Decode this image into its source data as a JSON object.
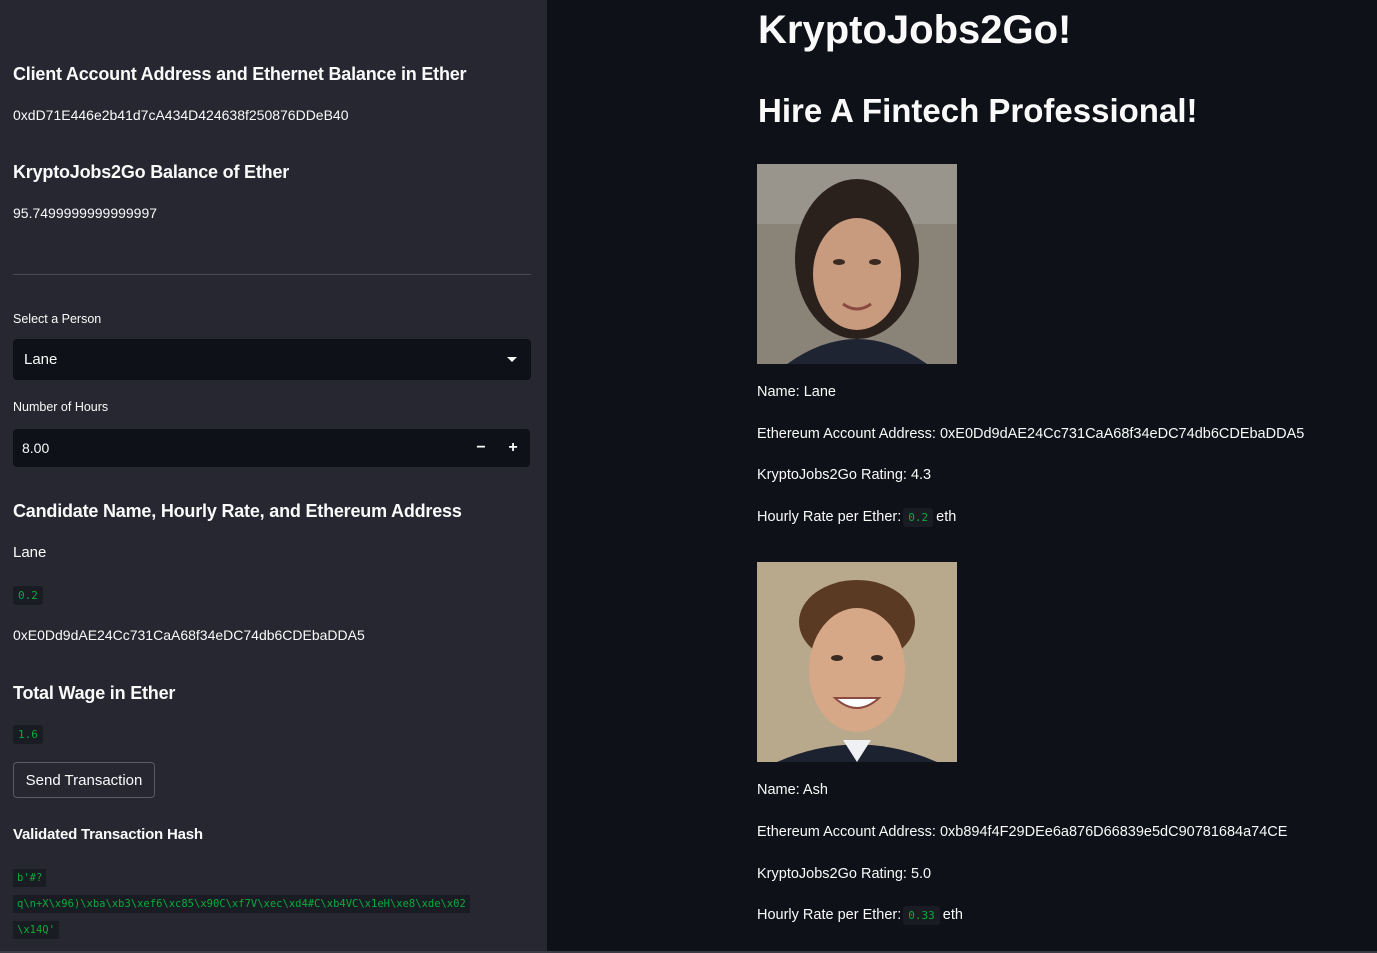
{
  "sidebar": {
    "client_heading": "Client Account Address and Ethernet Balance in Ether",
    "client_address": "0xdD71E446e2b41d7cA434D424638f250876DDeB40",
    "balance_heading": "KryptoJobs2Go Balance of Ether",
    "balance_value": "95.7499999999999997",
    "select_label": "Select a Person",
    "select_value": "Lane",
    "hours_label": "Number of Hours",
    "hours_value": "8.00",
    "minus": "−",
    "plus": "+",
    "candidate_heading": "Candidate Name, Hourly Rate, and Ethereum Address",
    "candidate_name": "Lane",
    "candidate_rate": "0.2",
    "candidate_address": "0xE0Dd9dAE24Cc731CaA68f34eDC74db6CDEbaDDA5",
    "wage_heading": "Total Wage in Ether",
    "wage_value": "1.6",
    "send_button": "Send Transaction",
    "hash_heading": "Validated Transaction Hash",
    "hash_lines": [
      "b'#?",
      "q\\n+X\\x96)\\xba\\xb3\\xef6\\xc85\\x90C\\xf7V\\xec\\xd4#C\\xb4VC\\x1eH\\xe8\\xde\\x02",
      "\\x14Q'"
    ]
  },
  "main": {
    "title": "KryptoJobs2Go!",
    "subtitle": "Hire A Fintech Professional!",
    "candidates": [
      {
        "name": "Name: Lane",
        "address": "Ethereum Account Address: 0xE0Dd9dAE24Cc731CaA68f34eDC74db6CDEbaDDA5",
        "rating": "KryptoJobs2Go Rating: 4.3",
        "rate_label": "Hourly Rate per Ether:",
        "rate_value": "0.2",
        "rate_unit": "eth"
      },
      {
        "name": "Name: Ash",
        "address": "Ethereum Account Address: 0xb894f4F29DEe6a876D66839e5dC90781684a74CE",
        "rating": "KryptoJobs2Go Rating: 5.0",
        "rate_label": "Hourly Rate per Ether:",
        "rate_value": "0.33",
        "rate_unit": "eth"
      }
    ]
  },
  "colors": {
    "sidebar_bg": "#262730",
    "main_bg": "#0e1117",
    "code_green": "#09ab3b"
  }
}
